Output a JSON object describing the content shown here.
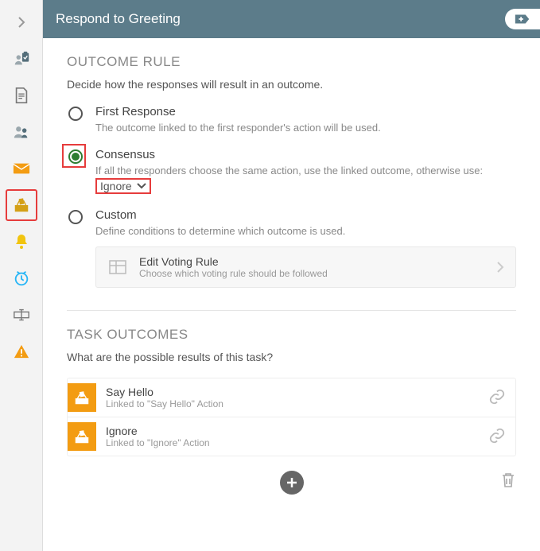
{
  "header": {
    "title": "Respond to Greeting"
  },
  "sidebar": {
    "items": [
      {
        "name": "collapse",
        "icon": "chevron"
      },
      {
        "name": "clipboard-people",
        "icon": "clipboard-person"
      },
      {
        "name": "document",
        "icon": "document"
      },
      {
        "name": "people",
        "icon": "people"
      },
      {
        "name": "mail",
        "icon": "mail"
      },
      {
        "name": "ballot",
        "icon": "ballot",
        "highlighted": true
      },
      {
        "name": "bell",
        "icon": "bell"
      },
      {
        "name": "clock",
        "icon": "clock"
      },
      {
        "name": "text-cursor",
        "icon": "cursor"
      },
      {
        "name": "warning",
        "icon": "warning"
      }
    ]
  },
  "outcome_rule": {
    "heading": "OUTCOME RULE",
    "description": "Decide how the responses will result in an outcome.",
    "options": {
      "first_response": {
        "label": "First Response",
        "description": "The outcome linked to the first responder's action will be used."
      },
      "consensus": {
        "label": "Consensus",
        "description": "If all the responders choose the same action, use the linked outcome, otherwise use:",
        "dropdown_value": "Ignore"
      },
      "custom": {
        "label": "Custom",
        "description": "Define conditions to determine which outcome is used."
      }
    },
    "edit_rule": {
      "title": "Edit Voting Rule",
      "subtitle": "Choose which voting rule should be followed"
    }
  },
  "task_outcomes": {
    "heading": "TASK OUTCOMES",
    "description": "What are the possible results of this task?",
    "items": [
      {
        "title": "Say Hello",
        "subtitle": "Linked to \"Say Hello\" Action"
      },
      {
        "title": "Ignore",
        "subtitle": "Linked to \"Ignore\" Action"
      }
    ]
  }
}
